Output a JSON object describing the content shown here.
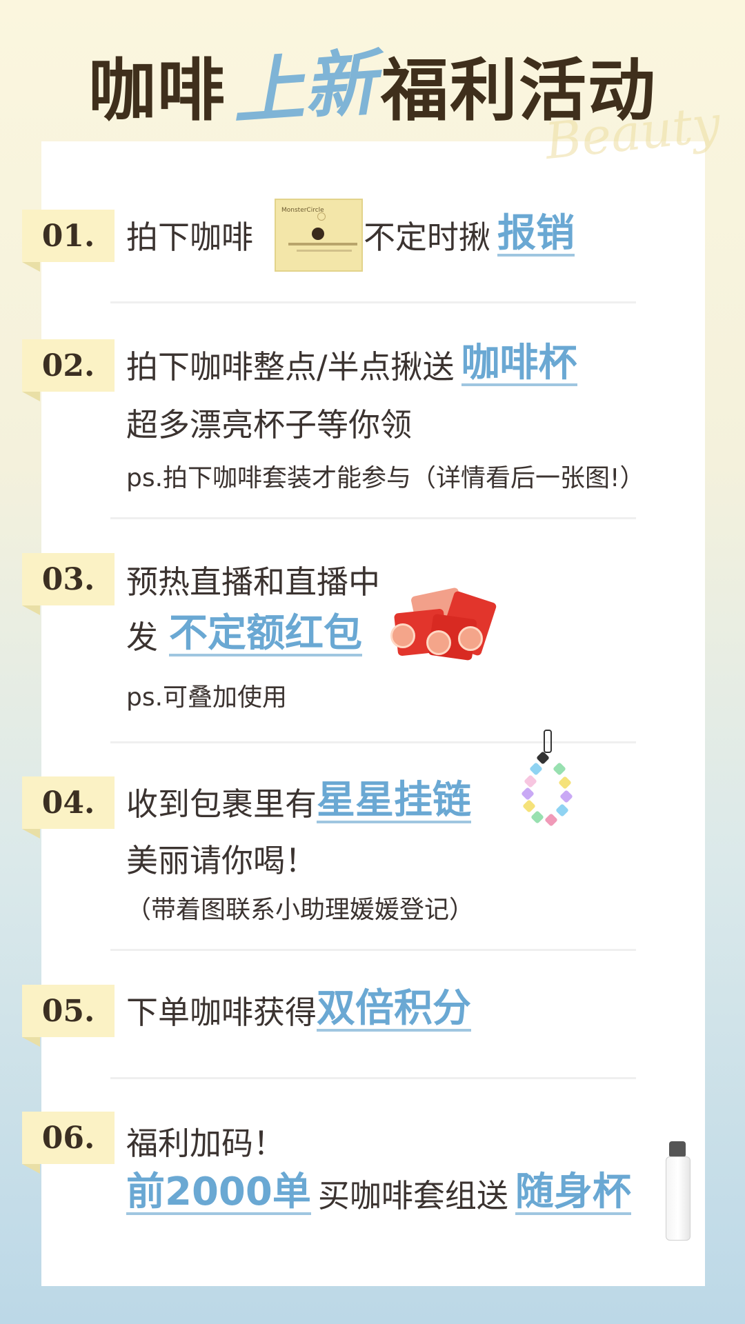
{
  "title": {
    "part1": "咖啡",
    "script": "上新",
    "part2": "福利活动",
    "watermark": "Beauty"
  },
  "items": [
    {
      "num": "01.",
      "line1_pre": "拍下咖啡",
      "line1_mid": "不定时揪",
      "line1_hl": "报销",
      "product": {
        "brand": "MonsterCircle"
      }
    },
    {
      "num": "02.",
      "line1_pre": "拍下咖啡整点/半点揪送",
      "line1_hl": "咖啡杯",
      "line2": "超多漂亮杯子等你领",
      "note": "ps.拍下咖啡套装才能参与（详情看后一张图!）"
    },
    {
      "num": "03.",
      "line1": "预热直播和直播中",
      "line2_pre": "发",
      "line2_hl": "不定额红包",
      "note": "ps.可叠加使用"
    },
    {
      "num": "04.",
      "line1_pre": "收到包裹里有",
      "line1_hl": "星星挂链",
      "line2": "美丽请你喝！",
      "note": "（带着图联系小助理媛媛登记）"
    },
    {
      "num": "05.",
      "line1_pre": "下单咖啡获得",
      "line1_hl": "双倍积分"
    },
    {
      "num": "06.",
      "line1": "福利加码！",
      "line2_hl1": "前2000单",
      "line2_mid": "买咖啡套组送",
      "line2_hl2": "随身杯"
    }
  ],
  "colors": {
    "highlight": "#6aa8d3",
    "number_tag": "#fbf2c5",
    "text": "#3b3330"
  }
}
